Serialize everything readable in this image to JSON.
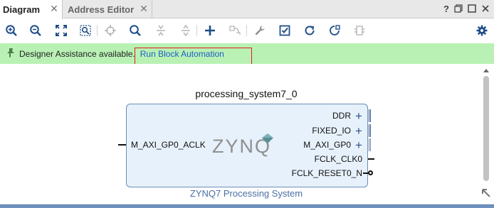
{
  "tabs": [
    {
      "label": "Diagram",
      "active": true,
      "close": "✕"
    },
    {
      "label": "Address Editor",
      "active": false,
      "close": "✕"
    }
  ],
  "window_controls": [
    "help-icon",
    "restore-icon",
    "maximize-icon",
    "close-icon"
  ],
  "window_control_glyphs": {
    "help": "?",
    "restore": "❐",
    "maximize": "□",
    "close": "✕"
  },
  "toolbar": {
    "icons": [
      "zoom-in-icon",
      "zoom-out-icon",
      "zoom-fit-icon",
      "zoom-area-icon",
      "center-icon",
      "search-icon",
      "collapse-vertical-icon",
      "expand-vertical-icon",
      "add-ip-icon",
      "make-connection-icon",
      "properties-wrench-icon",
      "validate-icon",
      "regenerate-icon",
      "optimize-routing-icon",
      "ports-icon",
      "settings-gear-icon"
    ]
  },
  "banner": {
    "message": "Designer Assistance available.",
    "link": "Run Block Automation",
    "background": "#b9f1b4",
    "link_color": "#1b5ec9"
  },
  "block": {
    "instance_name": "processing_system7_0",
    "subtitle": "ZYNQ7 Processing System",
    "logo_text": "ZYNQ",
    "left_port": "M_AXI_GP0_ACLK",
    "right_ports": [
      {
        "label": "DDR",
        "type": "bus"
      },
      {
        "label": "FIXED_IO",
        "type": "bus"
      },
      {
        "label": "M_AXI_GP0",
        "type": "bus"
      },
      {
        "label": "FCLK_CLK0",
        "type": "wire"
      },
      {
        "label": "FCLK_RESET0_N",
        "type": "inverted"
      }
    ],
    "fill_color": "#e7f1fb",
    "border_color": "#6b8eb6"
  },
  "plus_glyph": "+",
  "colors": {
    "accent_blue": "#2a4f87",
    "highlight_red": "#e21b1b",
    "bottom_bar": "#6f92c0"
  }
}
